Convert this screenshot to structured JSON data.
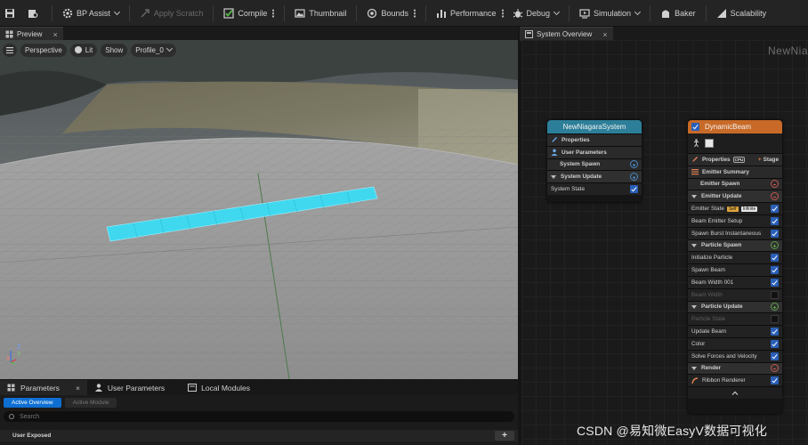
{
  "toolbar": {
    "bp_assist": "BP Assist",
    "apply_scratch": "Apply Scratch",
    "compile": "Compile",
    "thumbnail": "Thumbnail",
    "bounds": "Bounds",
    "performance": "Performance",
    "debug": "Debug",
    "simulation": "Simulation",
    "baker": "Baker",
    "scalability": "Scalability"
  },
  "preview_tab": {
    "label": "Preview"
  },
  "viewport": {
    "perspective": "Perspective",
    "lit": "Lit",
    "show": "Show",
    "profile": "Profile_0",
    "axis_z": "Z",
    "axis_y": "Y",
    "axis_x": "X",
    "beam_color": "#3fd8ef"
  },
  "params": {
    "tabs": [
      "Parameters",
      "User Parameters",
      "Local Modules"
    ],
    "active_overview": "Active Overview",
    "active_module": "Active Module",
    "search_placeholder": "Search",
    "user_exposed": "User Exposed",
    "add": "+"
  },
  "overview": {
    "tab_label": "System Overview",
    "graph_title": "NewNia",
    "system_node": {
      "title": "NewNiagaraSystem",
      "header_color": "#2d7f99",
      "rows": {
        "properties": "Properties",
        "user_parameters": "User Parameters",
        "system_spawn": "System Spawn",
        "system_update": "System Update",
        "system_state": "System State"
      }
    },
    "emitter_node": {
      "title": "DynamicBeam",
      "header_color": "#c86a27",
      "properties": "Properties",
      "gpu": "CPU",
      "stage": "Stage",
      "emitter_summary": "Emitter Summary",
      "emitter_spawn": "Emitter Spawn",
      "emitter_update": "Emitter Update",
      "emitter_state": "Emitter State",
      "self": "Self",
      "infinite": "Infinite",
      "beam_emitter_setup": "Beam Emitter Setup",
      "spawn_burst": "Spawn Burst Instantaneous",
      "particle_spawn": "Particle Spawn",
      "initialize_particle": "Initialize Particle",
      "spawn_beam": "Spawn Beam",
      "beam_width_001": "Beam Width 001",
      "beam_width": "Beam Width",
      "particle_update": "Particle Update",
      "particle_state": "Particle State",
      "update_beam": "Update Beam",
      "color": "Color",
      "solve_forces": "Solve Forces and Velocity",
      "render": "Render",
      "ribbon_renderer": "Ribbon Renderer",
      "collapse": "^"
    }
  },
  "watermark": "CSDN @易知微EasyV数据可视化"
}
